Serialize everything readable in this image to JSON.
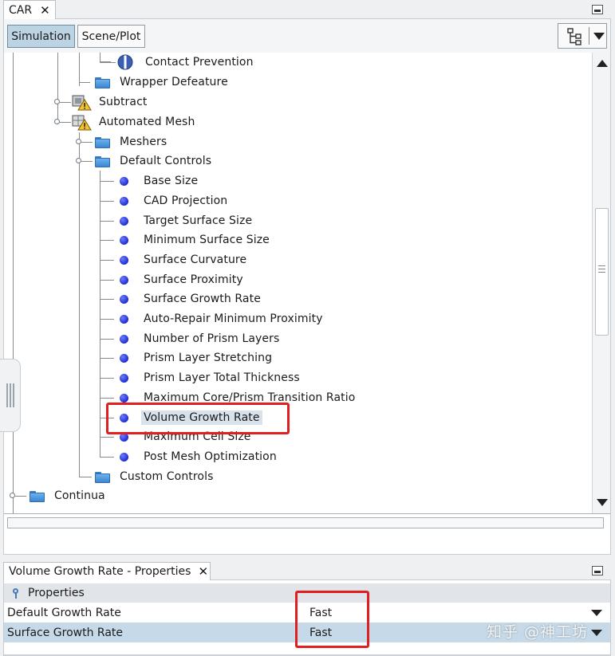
{
  "window": {
    "tab_label": "CAR",
    "tab_close": "✕"
  },
  "toolbar": {
    "simulation_label": "Simulation",
    "scene_plot_label": "Scene/Plot"
  },
  "tree": {
    "items": [
      {
        "label": "Contact Prevention",
        "icon": "contact-prevention-icon"
      },
      {
        "label": "Wrapper Defeature",
        "icon": "folder-icon"
      },
      {
        "label": "Subtract",
        "icon": "warning-operation-icon"
      },
      {
        "label": "Automated Mesh",
        "icon": "warning-operation-icon"
      },
      {
        "label": "Meshers",
        "icon": "folder-icon"
      },
      {
        "label": "Default Controls",
        "icon": "folder-icon"
      },
      {
        "label": "Base Size",
        "icon": "dot-icon"
      },
      {
        "label": "CAD Projection",
        "icon": "dot-icon"
      },
      {
        "label": "Target Surface Size",
        "icon": "dot-icon"
      },
      {
        "label": "Minimum Surface Size",
        "icon": "dot-icon"
      },
      {
        "label": "Surface Curvature",
        "icon": "dot-icon"
      },
      {
        "label": "Surface Proximity",
        "icon": "dot-icon"
      },
      {
        "label": "Surface Growth Rate",
        "icon": "dot-icon"
      },
      {
        "label": "Auto-Repair Minimum Proximity",
        "icon": "dot-icon"
      },
      {
        "label": "Number of Prism Layers",
        "icon": "dot-icon"
      },
      {
        "label": "Prism Layer Stretching",
        "icon": "dot-icon"
      },
      {
        "label": "Prism Layer Total Thickness",
        "icon": "dot-icon"
      },
      {
        "label": "Maximum Core/Prism Transition Ratio",
        "icon": "dot-icon"
      },
      {
        "label": "Volume Growth Rate",
        "icon": "dot-icon"
      },
      {
        "label": "Maximum Cell Size",
        "icon": "dot-icon"
      },
      {
        "label": "Post Mesh Optimization",
        "icon": "dot-icon"
      },
      {
        "label": "Custom Controls",
        "icon": "folder-icon"
      },
      {
        "label": "Continua",
        "icon": "folder-icon"
      }
    ]
  },
  "properties": {
    "tab_label": "Volume Growth Rate - Properties",
    "tab_close": "✕",
    "section_label": "Properties",
    "rows": [
      {
        "name": "Default Growth Rate",
        "value": "Fast"
      },
      {
        "name": "Surface Growth Rate",
        "value": "Fast"
      }
    ]
  },
  "watermark": "知乎 @神工坊",
  "colors": {
    "highlight_box": "#e02020",
    "selected_row": "#c5d9e8",
    "active_tab": "#bcd3e3"
  }
}
